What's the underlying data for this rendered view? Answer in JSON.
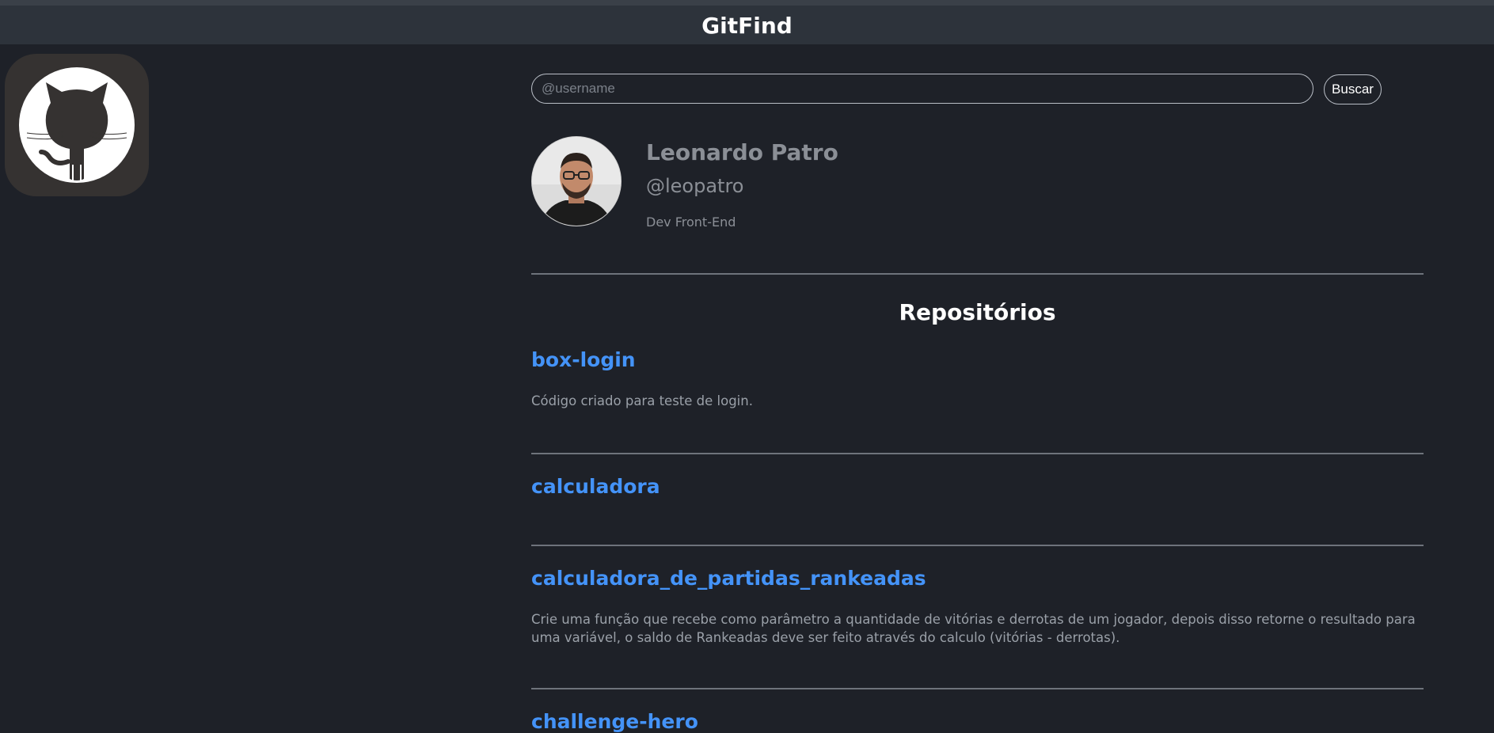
{
  "app": {
    "title": "GitFind"
  },
  "logo": {
    "icon": "github-octocat-icon"
  },
  "search": {
    "placeholder": "@username",
    "value": "",
    "button_label": "Buscar"
  },
  "profile": {
    "name": "Leonardo Patro",
    "username": "@leopatro",
    "bio": "Dev Front-End",
    "avatar_icon": "user-avatar-photo"
  },
  "repos": {
    "title": "Repositórios",
    "items": [
      {
        "name": "box-login",
        "description": "Código criado para teste de login."
      },
      {
        "name": "calculadora",
        "description": ""
      },
      {
        "name": "calculadora_de_partidas_rankeadas",
        "description": "Crie uma função que recebe como parâmetro a quantidade de vitórias e derrotas de um jogador, depois disso retorne o resultado para uma variável, o saldo de Rankeadas deve ser feito através do calculo (vitórias - derrotas)."
      },
      {
        "name": "challenge-hero",
        "description": ""
      }
    ]
  },
  "colors": {
    "background": "#1e2128",
    "header": "#2d333b",
    "link": "#4493f8",
    "muted_text": "#8b8f96"
  }
}
